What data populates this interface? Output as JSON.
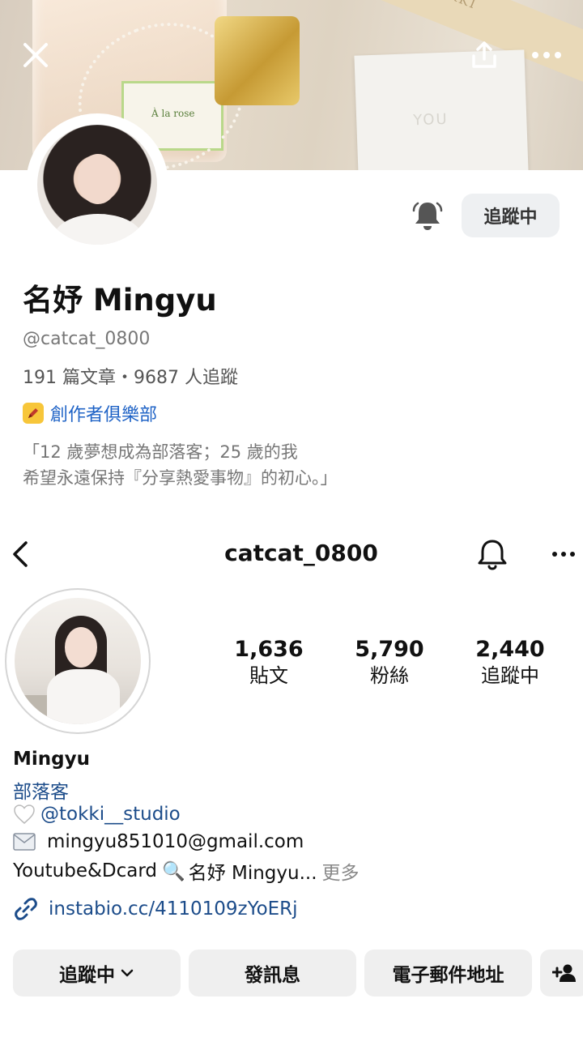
{
  "top": {
    "cover": {
      "label_text": "À la rose",
      "card_text": "YOU",
      "ribbon_text": "TOKKI"
    },
    "icons": {
      "close": "close-icon",
      "share": "share-icon",
      "more": "more-horizontal-icon",
      "bell": "bell-icon",
      "club_badge": "pen-icon"
    },
    "follow_button": "追蹤中",
    "name": "名妤 Mingyu",
    "handle": "@catcat_0800",
    "stats": "191 篇文章・9687 人追蹤",
    "club_label": "創作者俱樂部",
    "bio_line1": "「12 歲夢想成為部落客；25 歲的我",
    "bio_line2": "希望永遠保持『分享熱愛事物』的初心。」",
    "colors": {
      "link": "#1f63c6",
      "badge": "#f7c63a",
      "button_bg": "#eef0f2"
    }
  },
  "ig": {
    "username": "catcat_0800",
    "more_glyph": "···",
    "stats": [
      {
        "value": "1,636",
        "label": "貼文"
      },
      {
        "value": "5,790",
        "label": "粉絲"
      },
      {
        "value": "2,440",
        "label": "追蹤中"
      }
    ],
    "name": "Mingyu",
    "category": "部落客",
    "bio": {
      "mention": "@tokki__studio",
      "email": "mingyu851010@gmail.com",
      "line3_prefix": "Youtube&Dcard",
      "line3_search_icon": "🔍",
      "line3_text": "名妤 Mingyu...",
      "more": "更多"
    },
    "link": "instabio.cc/4110109zYoERj",
    "buttons": {
      "following": "追蹤中",
      "message": "發訊息",
      "email": "電子郵件地址"
    },
    "colors": {
      "link": "#1c4c8a",
      "button_bg": "#efefef"
    }
  }
}
